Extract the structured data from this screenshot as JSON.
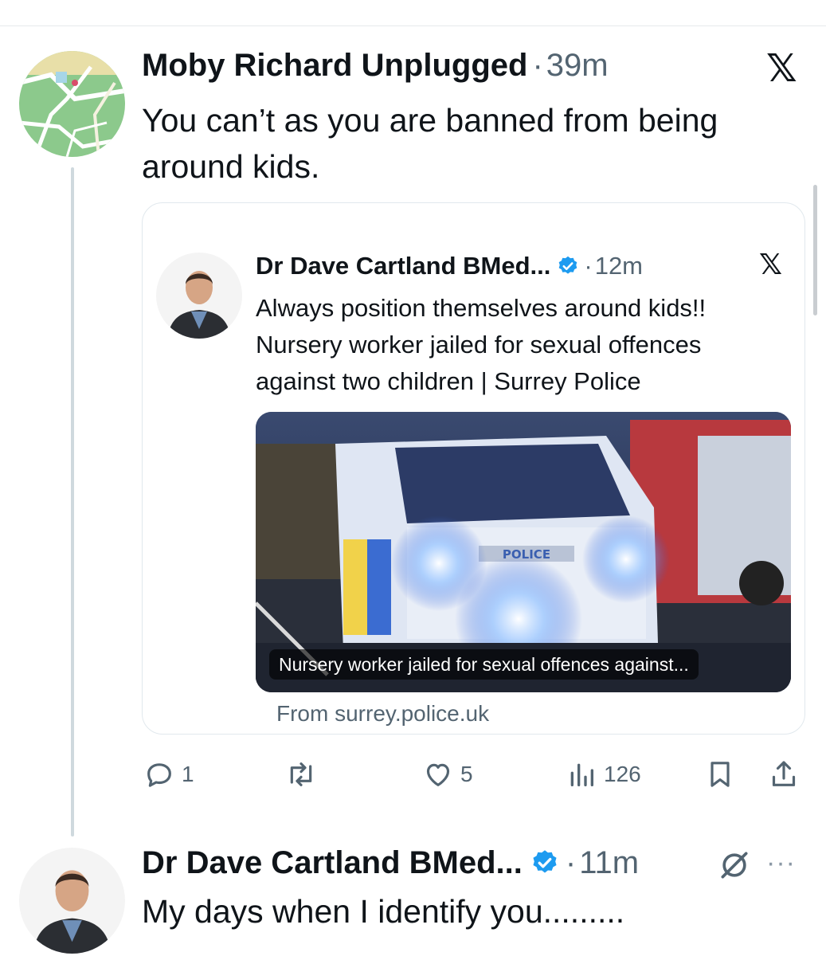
{
  "reply": {
    "author": "Moby Richard Unplugged",
    "separator": "·",
    "time": "39m",
    "text_line1": "You can’t as you are banned from being",
    "text_line2": "around kids.",
    "avatar_icon": "map-avatar-icon",
    "logo_icon": "x-logo-icon"
  },
  "quoted": {
    "author": "Dr Dave Cartland BMed...",
    "separator": "·",
    "time": "12m",
    "text_line1": "Always position themselves around kids!!",
    "text_line2": "Nursery worker jailed for sexual offences",
    "text_line3": "against two children | Surrey Police",
    "media_caption": "Nursery worker jailed for sexual offences against...",
    "police_livery_text": "POLICE",
    "source": "From surrey.police.uk",
    "verified_icon": "verified-badge-icon"
  },
  "actions": {
    "replies": "1",
    "reposts": "",
    "likes": "5",
    "views": "126"
  },
  "second_reply": {
    "author": "Dr Dave Cartland BMed...",
    "separator": "·",
    "time": "11m",
    "text": "My days when I identify you.........",
    "more": "···",
    "grok_icon": "grok-icon"
  },
  "colors": {
    "verified": "#1d9bf0",
    "secondary_text": "#536471",
    "border": "#e1e8ed",
    "thread_line": "#cfd9de"
  }
}
